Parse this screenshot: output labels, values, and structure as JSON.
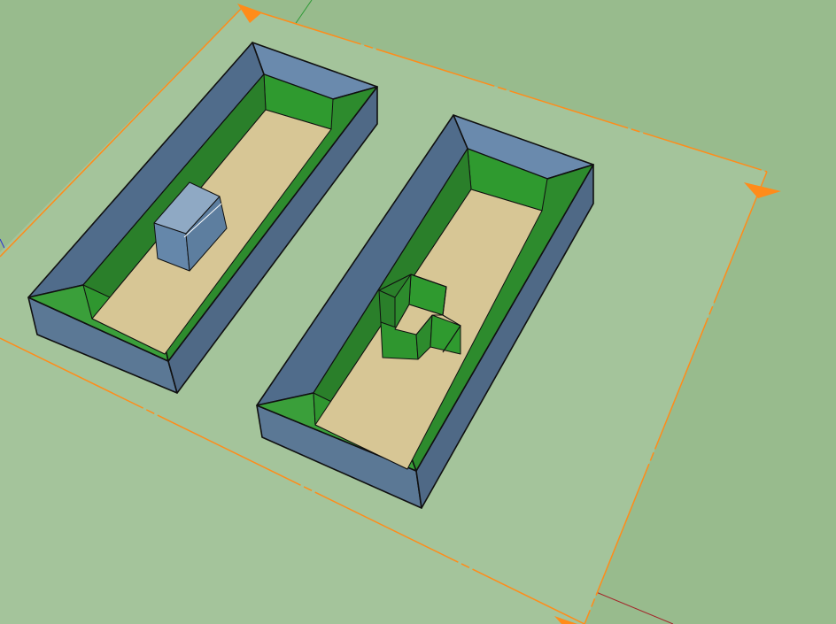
{
  "scene": {
    "background_color": "#98bb8d",
    "ground_plane_color": "#a4c49b",
    "selection_color": "#ff8c1a",
    "axis_colors": {
      "red": "#a3252a",
      "green": "#2e9a36",
      "blue": "#2a2cd6"
    },
    "materials": {
      "outer_wall": "#5b7895",
      "outer_wall_dark": "#4a6380",
      "roof_top": "#6a8aad",
      "inner_wall_green": "#2d8b2d",
      "inner_wall_green_light": "#3aa43a",
      "floor_tan": "#d7c695",
      "column_blue": "#6587aa"
    },
    "objects": [
      {
        "name": "left-enclosure",
        "has_column": true
      },
      {
        "name": "right-enclosure",
        "has_cross_column": true
      }
    ]
  }
}
